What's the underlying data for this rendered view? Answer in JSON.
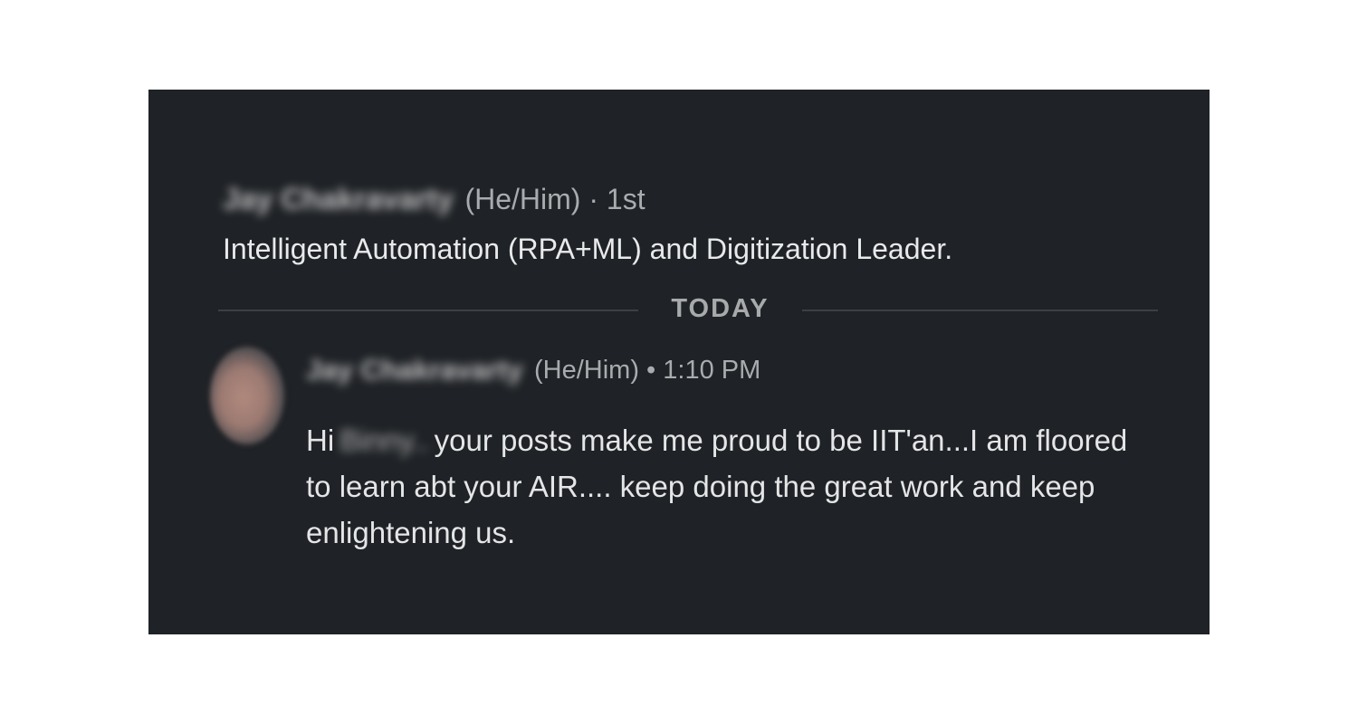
{
  "conversation": {
    "header": {
      "name": "Jay Chakravarty",
      "pronouns_connection": "(He/Him) · 1st",
      "headline": "Intelligent Automation (RPA+ML) and Digitization Leader."
    },
    "divider_label": "TODAY",
    "message": {
      "sender_name": "Jay Chakravarty",
      "meta": "(He/Him) • 1:10 PM",
      "text_prefix": "Hi",
      "redacted_name": "Binny..",
      "text_rest": "your posts make me proud to be IIT'an...I am floored to learn abt your AIR.... keep doing the great work and keep enlightening us."
    }
  },
  "colors": {
    "card_background": "#1f2226",
    "primary_text": "#e8e9ea",
    "secondary_text": "#a9acae",
    "divider_line": "#3c4045"
  },
  "icons": {
    "avatar": "profile-photo"
  }
}
